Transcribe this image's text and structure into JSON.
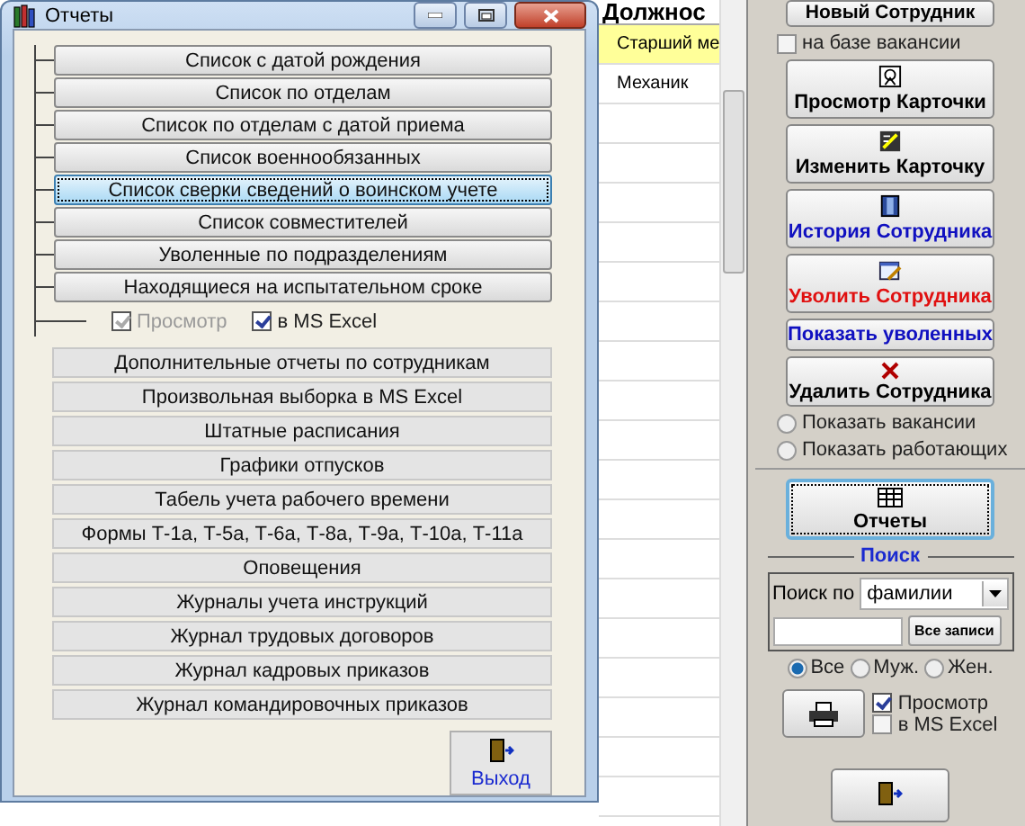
{
  "table": {
    "column_header": "Должнос",
    "rows": [
      {
        "cell": "Старший ме",
        "selected": true
      },
      {
        "cell": "Механик",
        "selected": false
      }
    ]
  },
  "side_panel": {
    "new_button": "Новый Сотрудник",
    "vacancy_checkbox": {
      "label": "на базе вакансии",
      "checked": false
    },
    "actions": [
      {
        "label": "Просмотр Карточки",
        "kind": "view"
      },
      {
        "label": "Изменить Карточку",
        "kind": "edit"
      },
      {
        "label": "История Сотрудника",
        "kind": "history"
      },
      {
        "label": "Уволить Сотрудника",
        "kind": "dismiss"
      },
      {
        "label": "Показать уволенных",
        "kind": "link"
      },
      {
        "label": "Удалить Сотрудника",
        "kind": "delete"
      }
    ],
    "show_options": [
      {
        "label": "Показать вакансии",
        "selected": false
      },
      {
        "label": "Показать работающих",
        "selected": false
      }
    ],
    "reports_button": "Отчеты",
    "search": {
      "title": "Поиск",
      "label": "Поиск по",
      "field": "фамилии",
      "all_button": "Все записи",
      "gender": [
        {
          "label": "Все",
          "selected": true
        },
        {
          "label": "Муж.",
          "selected": false
        },
        {
          "label": "Жен.",
          "selected": false
        }
      ]
    },
    "print_options": [
      {
        "label": "Просмотр",
        "checked": true
      },
      {
        "label": "в MS Excel",
        "checked": false
      }
    ]
  },
  "dialog": {
    "title": "Отчеты",
    "tree_buttons": [
      {
        "label": "Список с датой рождения",
        "selected": false
      },
      {
        "label": "Список по отделам",
        "selected": false
      },
      {
        "label": "Список по отделам с датой приема",
        "selected": false
      },
      {
        "label": "Список военнообязанных",
        "selected": false
      },
      {
        "label": "Список сверки сведений о воинском учете",
        "selected": true
      },
      {
        "label": "Список совместителей",
        "selected": false
      },
      {
        "label": "Уволенные по подразделениям",
        "selected": false
      },
      {
        "label": "Находящиеся на испытательном сроке",
        "selected": false
      }
    ],
    "options": [
      {
        "label": "Просмотр",
        "checked": true,
        "disabled": true
      },
      {
        "label": "в MS Excel",
        "checked": true,
        "disabled": false
      }
    ],
    "report_buttons": [
      "Дополнительные отчеты по сотрудникам",
      "Произвольная выборка в MS Excel",
      "Штатные расписания",
      "Графики отпусков",
      "Табель учета рабочего времени",
      "Формы Т-1а, Т-5а, Т-6а, Т-8а, Т-9а, Т-10а, Т-11а",
      "Оповещения",
      "Журналы учета инструкций",
      "Журнал трудовых договоров",
      "Журнал кадровых приказов",
      "Журнал командировочных приказов"
    ],
    "exit_button": "Выход"
  }
}
